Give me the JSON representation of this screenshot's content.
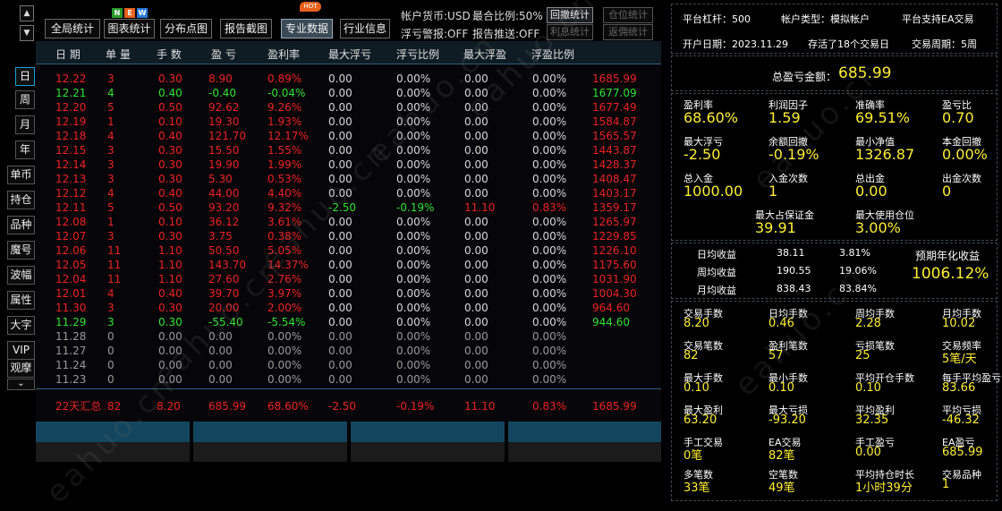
{
  "watermark": "eahuo.cn",
  "colors": {
    "profit": "#ee2222",
    "loss": "#2ee32e",
    "neutral": "#9a9a9a",
    "accent": "#1aa0d8",
    "value": "#ffee33",
    "header": "#101c24"
  },
  "nav": {
    "up_icon": "▲",
    "down_icon": "▼",
    "period": [
      "日",
      "周",
      "月",
      "年"
    ],
    "filters": [
      "单币",
      "持仓",
      "品种",
      "魔号",
      "波幅",
      "属性",
      "大字",
      "VIP",
      "观摩"
    ],
    "more_icon": "⌄"
  },
  "toolbar": {
    "buttons": [
      "全局统计",
      "图表统计",
      "分布点图",
      "报告截图",
      "专业数据",
      "行业信息"
    ],
    "new_letters": [
      "N",
      "E",
      "W"
    ],
    "hot_label": "HOT",
    "account_currency": "帐户货币:USD",
    "max_position_ratio": "最合比例:50%",
    "float_alert": "浮亏警报:OFF",
    "report_push": "报告推送:OFF",
    "small_buttons": [
      "回撤统计",
      "仓位统计",
      "利息统计",
      "返佣统计"
    ]
  },
  "table": {
    "headers": [
      "日 期",
      "单 量",
      "手 数",
      "盈 亏",
      "盈利率",
      "最大浮亏",
      "浮亏比例",
      "最大浮盈",
      "浮盈比例",
      ""
    ],
    "rows": [
      [
        "12.22",
        "3",
        "0.30",
        "8.90",
        "0.89%",
        "0.00",
        "0.00%",
        "0.00",
        "0.00%",
        "1685.99",
        "red"
      ],
      [
        "12.21",
        "4",
        "0.40",
        "-0.40",
        "-0.04%",
        "0.00",
        "0.00%",
        "0.00",
        "0.00%",
        "1677.09",
        "green"
      ],
      [
        "12.20",
        "5",
        "0.50",
        "92.62",
        "9.26%",
        "0.00",
        "0.00%",
        "0.00",
        "0.00%",
        "1677.49",
        "red"
      ],
      [
        "12.19",
        "1",
        "0.10",
        "19.30",
        "1.93%",
        "0.00",
        "0.00%",
        "0.00",
        "0.00%",
        "1584.87",
        "red"
      ],
      [
        "12.18",
        "4",
        "0.40",
        "121.70",
        "12.17%",
        "0.00",
        "0.00%",
        "0.00",
        "0.00%",
        "1565.57",
        "red"
      ],
      [
        "12.15",
        "3",
        "0.30",
        "15.50",
        "1.55%",
        "0.00",
        "0.00%",
        "0.00",
        "0.00%",
        "1443.87",
        "red"
      ],
      [
        "12.14",
        "3",
        "0.30",
        "19.90",
        "1.99%",
        "0.00",
        "0.00%",
        "0.00",
        "0.00%",
        "1428.37",
        "red"
      ],
      [
        "12.13",
        "3",
        "0.30",
        "5.30",
        "0.53%",
        "0.00",
        "0.00%",
        "0.00",
        "0.00%",
        "1408.47",
        "red"
      ],
      [
        "12.12",
        "4",
        "0.40",
        "44.00",
        "4.40%",
        "0.00",
        "0.00%",
        "0.00",
        "0.00%",
        "1403.17",
        "red"
      ],
      [
        "12.11",
        "5",
        "0.50",
        "93.20",
        "9.32%",
        "-2.50",
        "-0.19%",
        "11.10",
        "0.83%",
        "1359.17",
        "red"
      ],
      [
        "12.08",
        "1",
        "0.10",
        "36.12",
        "3.61%",
        "0.00",
        "0.00%",
        "0.00",
        "0.00%",
        "1265.97",
        "red"
      ],
      [
        "12.07",
        "3",
        "0.30",
        "3.75",
        "0.38%",
        "0.00",
        "0.00%",
        "0.00",
        "0.00%",
        "1229.85",
        "red"
      ],
      [
        "12.06",
        "11",
        "1.10",
        "50.50",
        "5.05%",
        "0.00",
        "0.00%",
        "0.00",
        "0.00%",
        "1226.10",
        "red"
      ],
      [
        "12.05",
        "11",
        "1.10",
        "143.70",
        "14.37%",
        "0.00",
        "0.00%",
        "0.00",
        "0.00%",
        "1175.60",
        "red"
      ],
      [
        "12.04",
        "11",
        "1.10",
        "27.60",
        "2.76%",
        "0.00",
        "0.00%",
        "0.00",
        "0.00%",
        "1031.90",
        "red"
      ],
      [
        "12.01",
        "4",
        "0.40",
        "39.70",
        "3.97%",
        "0.00",
        "0.00%",
        "0.00",
        "0.00%",
        "1004.30",
        "red"
      ],
      [
        "11.30",
        "3",
        "0.30",
        "20.00",
        "2.00%",
        "0.00",
        "0.00%",
        "0.00",
        "0.00%",
        "964.60",
        "red"
      ],
      [
        "11.29",
        "3",
        "0.30",
        "-55.40",
        "-5.54%",
        "0.00",
        "0.00%",
        "0.00",
        "0.00%",
        "944.60",
        "green"
      ],
      [
        "11.28",
        "0",
        "0.00",
        "0.00",
        "0.00%",
        "0.00",
        "0.00%",
        "0.00",
        "0.00%",
        "",
        "grey"
      ],
      [
        "11.27",
        "0",
        "0.00",
        "0.00",
        "0.00%",
        "0.00",
        "0.00%",
        "0.00",
        "0.00%",
        "",
        "grey"
      ],
      [
        "11.24",
        "0",
        "0.00",
        "0.00",
        "0.00%",
        "0.00",
        "0.00%",
        "0.00",
        "0.00%",
        "",
        "grey"
      ],
      [
        "11.23",
        "0",
        "0.00",
        "0.00",
        "0.00%",
        "0.00",
        "0.00%",
        "0.00",
        "0.00%",
        "",
        "grey"
      ]
    ],
    "summary": [
      "22天汇总",
      "82",
      "8.20",
      "685.99",
      "68.60%",
      "-2.50",
      "-0.19%",
      "11.10",
      "0.83%",
      "1685.99"
    ]
  },
  "right": {
    "platform_leverage": "平台杠杆：500",
    "account_type": "帐户类型：模拟帐户",
    "platform_ea": "平台支持EA交易",
    "open_date": "开户日期：2023.11.29",
    "stored_weeks": "存活了18个交易日",
    "trade_cycle": "交易周期：5周",
    "total_pl_label": "总盈亏金额：",
    "total_pl_value": "685.99",
    "stats1": [
      {
        "label": "盈利率",
        "value": "68.60%"
      },
      {
        "label": "利润因子",
        "value": "1.59"
      },
      {
        "label": "准确率",
        "value": "69.51%"
      },
      {
        "label": "盈亏比",
        "value": "0.70"
      },
      {
        "label": "最大浮亏",
        "value": "-2.50"
      },
      {
        "label": "余额回撤",
        "value": "-0.19%"
      },
      {
        "label": "最小净值",
        "value": "1326.87"
      },
      {
        "label": "本金回撤",
        "value": "0.00%"
      },
      {
        "label": "总入金",
        "value": "1000.00"
      },
      {
        "label": "入金次数",
        "value": "1"
      },
      {
        "label": "总出金",
        "value": "0.00"
      },
      {
        "label": "出金次数",
        "value": "0"
      }
    ],
    "margin": [
      {
        "label": "最大占保证金",
        "value": "39.91"
      },
      {
        "label": "最大使用仓位",
        "value": "3.00%"
      }
    ],
    "returns": [
      {
        "label": "日均收益",
        "amount": "38.11",
        "pct": "3.81%"
      },
      {
        "label": "周均收益",
        "amount": "190.55",
        "pct": "19.06%"
      },
      {
        "label": "月均收益",
        "amount": "838.43",
        "pct": "83.84%"
      }
    ],
    "annual_label": "预期年化收益",
    "annual_value": "1006.12%",
    "stats2": [
      {
        "label": "交易手数",
        "value": "8.20"
      },
      {
        "label": "日均手数",
        "value": "0.46"
      },
      {
        "label": "周均手数",
        "value": "2.28"
      },
      {
        "label": "月均手数",
        "value": "10.02"
      },
      {
        "label": "交易笔数",
        "value": "82"
      },
      {
        "label": "盈利笔数",
        "value": "57"
      },
      {
        "label": "亏损笔数",
        "value": "25"
      },
      {
        "label": "交易频率",
        "value": "5笔/天"
      },
      {
        "label": "最大手数",
        "value": "0.10"
      },
      {
        "label": "最小手数",
        "value": "0.10"
      },
      {
        "label": "平均开仓手数",
        "value": "0.10"
      },
      {
        "label": "每手平均盈亏",
        "value": "83.66"
      },
      {
        "label": "最大盈利",
        "value": "63.20"
      },
      {
        "label": "最大亏损",
        "value": "-93.20"
      },
      {
        "label": "平均盈利",
        "value": "32.35"
      },
      {
        "label": "平均亏损",
        "value": "-46.32"
      },
      {
        "label": "手工交易",
        "value": "0笔"
      },
      {
        "label": "EA交易",
        "value": "82笔"
      },
      {
        "label": "手工盈亏",
        "value": "0.00"
      },
      {
        "label": "EA盈亏",
        "value": "685.99"
      },
      {
        "label": "多笔数",
        "value": "33笔"
      },
      {
        "label": "空笔数",
        "value": "49笔"
      },
      {
        "label": "平均持仓时长",
        "value": "1小时39分"
      },
      {
        "label": "交易品种",
        "value": "1"
      }
    ]
  }
}
